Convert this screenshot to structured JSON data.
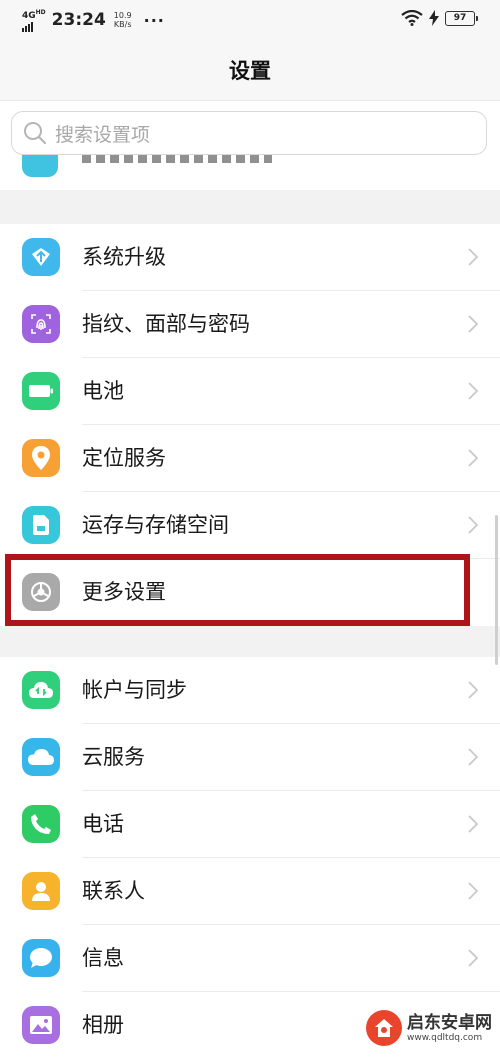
{
  "status_bar": {
    "network": "4G",
    "network_sup": "HD",
    "time": "23:24",
    "speed_value": "10.9",
    "speed_unit": "KB/s",
    "more": "···",
    "battery": "97"
  },
  "header": {
    "title": "设置"
  },
  "search": {
    "placeholder": "搜索设置项"
  },
  "groups": [
    {
      "items": [
        {
          "label": "系统升级",
          "icon": "system-update-icon",
          "color": "#41b8ec"
        },
        {
          "label": "指纹、面部与密码",
          "icon": "fingerprint-icon",
          "color": "#a063e0"
        },
        {
          "label": "电池",
          "icon": "battery-icon",
          "color": "#2fcf7c"
        },
        {
          "label": "定位服务",
          "icon": "location-pin-icon",
          "color": "#f7a033"
        },
        {
          "label": "运存与存储空间",
          "icon": "storage-card-icon",
          "color": "#37c7da"
        },
        {
          "label": "更多设置",
          "icon": "gear-icon",
          "color": "#a9a9a9"
        }
      ]
    },
    {
      "items": [
        {
          "label": "帐户与同步",
          "icon": "account-sync-icon",
          "color": "#2fcf7c"
        },
        {
          "label": "云服务",
          "icon": "cloud-icon",
          "color": "#37b6ea"
        },
        {
          "label": "电话",
          "icon": "phone-icon",
          "color": "#2fcc66"
        },
        {
          "label": "联系人",
          "icon": "contacts-icon",
          "color": "#f7b32b"
        },
        {
          "label": "信息",
          "icon": "message-icon",
          "color": "#38b2ec"
        },
        {
          "label": "相册",
          "icon": "gallery-icon",
          "color": "#a76fdf"
        }
      ]
    }
  ],
  "highlight_color": "#b0141a",
  "watermark": {
    "title": "启东安卓网",
    "url": "www.qdltdq.com"
  }
}
